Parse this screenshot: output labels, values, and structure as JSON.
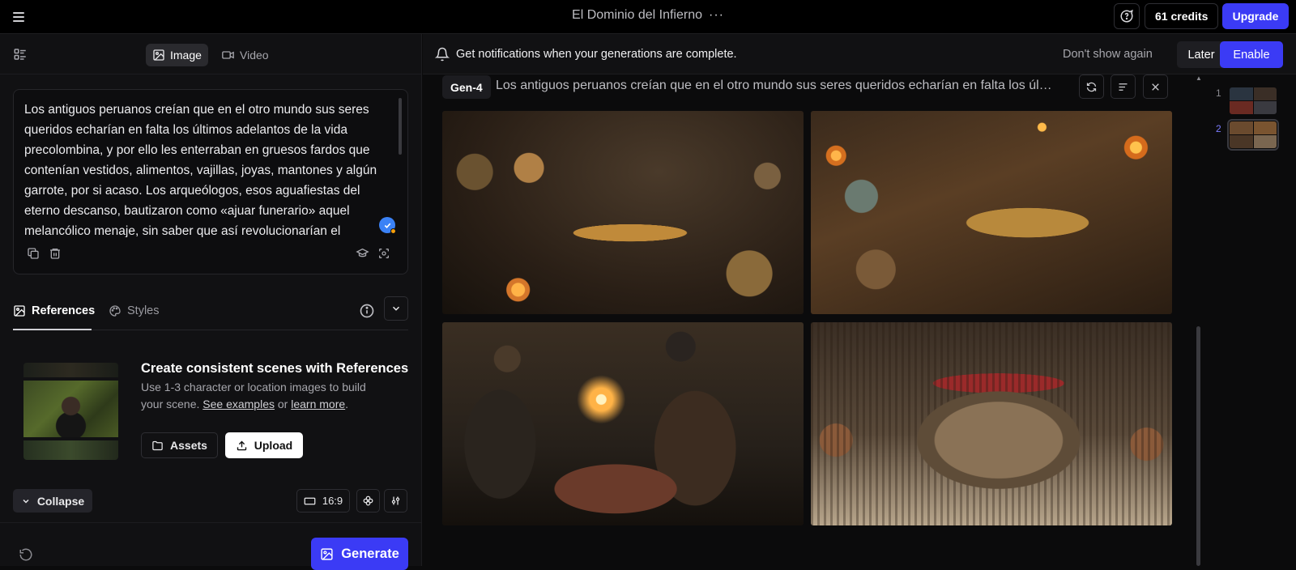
{
  "topbar": {
    "title": "El Dominio del Infierno",
    "more_icon": "more-horizontal-icon",
    "credits_label": "61 credits",
    "upgrade_label": "Upgrade"
  },
  "left_panel": {
    "mode_tabs": [
      {
        "label": "Image",
        "icon": "image-icon",
        "active": true
      },
      {
        "label": "Video",
        "icon": "video-icon",
        "active": false
      }
    ],
    "prompt_text": "Los antiguos peruanos creían que en el otro mundo sus seres queridos echarían en falta los últimos adelantos de la vida precolombina, y por ello les enterraban en gruesos fardos que contenían vestidos, alimentos, vajillas, joyas, mantones y algún garrote, por si acaso. Los arqueólogos, esos aguafiestas del eterno descanso, bautizaron como «ajuar funerario» aquel melancólico menaje, sin saber que así revolucionarían el",
    "references_tabs": [
      {
        "label": "References",
        "active": true
      },
      {
        "label": "Styles",
        "active": false
      }
    ],
    "references": {
      "title": "Create consistent scenes with References",
      "desc_prefix": "Use 1-3 character or location images to build your scene.",
      "see_examples": "See examples",
      "or": "or",
      "learn_more": "learn more",
      "period": ".",
      "assets_label": "Assets",
      "upload_label": "Upload"
    },
    "collapse_label": "Collapse",
    "aspect_ratio": "16:9",
    "generate_label": "Generate"
  },
  "notification": {
    "text": "Get notifications when your generations are complete.",
    "dont_show": "Don't show again",
    "later": "Later",
    "enable": "Enable"
  },
  "generation": {
    "model": "Gen-4",
    "prompt_preview": "Los antiguos peruanos creían que en el otro mundo sus seres queridos echarían en falta los últimos adelantos de la vida precolombina",
    "thumb_numbers": [
      "1",
      "2"
    ]
  },
  "colors": {
    "accent": "#3b3bf5",
    "background": "#0b0b0c",
    "panel": "#111113"
  }
}
